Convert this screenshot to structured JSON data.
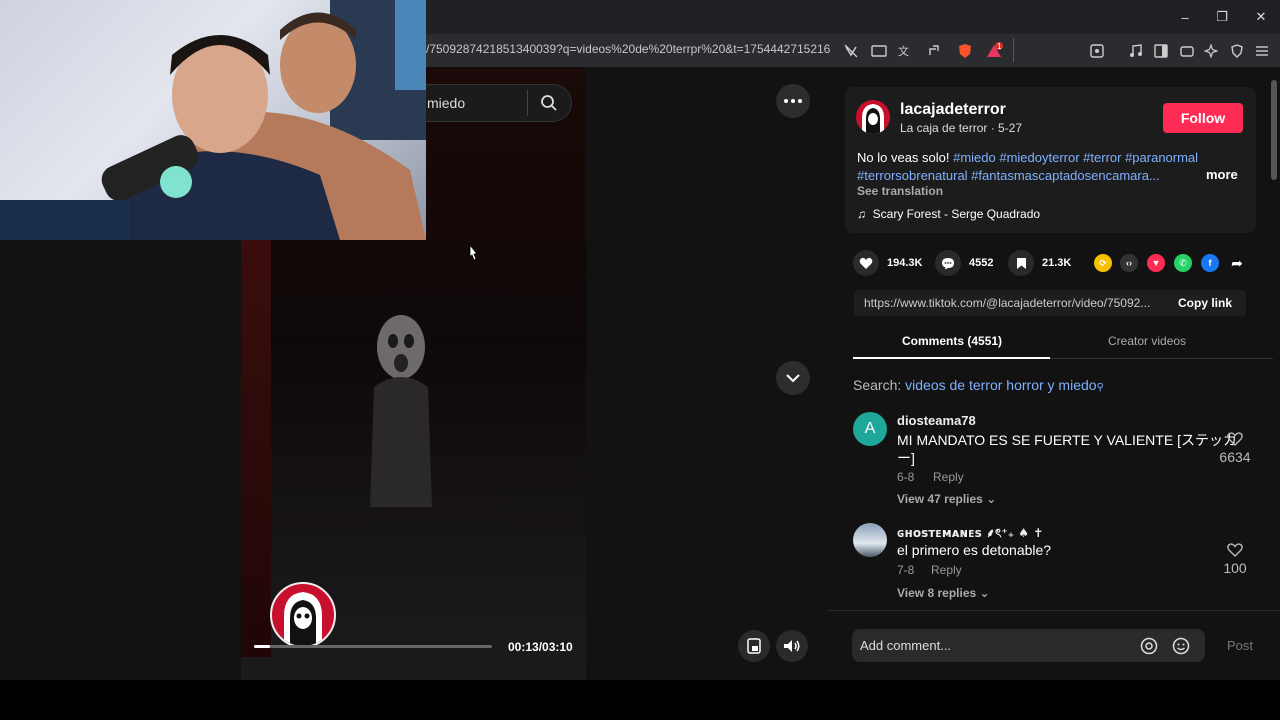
{
  "browser": {
    "url": "/7509287421851340039?q=videos%20de%20terrpr%20&t=1754442715216",
    "window_controls": [
      "–",
      "❐",
      "✕"
    ],
    "brave_badge": "1"
  },
  "video": {
    "search_text": "miedo",
    "time": "00:13/03:10",
    "progress": 0.068
  },
  "post": {
    "username": "lacajadeterror",
    "subline": "La caja de terror · 5-27",
    "follow_label": "Follow",
    "desc_plain": "No lo veas solo! ",
    "desc_tags1": "#miedo #miedoyterror #terror #paranormal",
    "desc_tags2": "#terrorsobrenatural #fantasmascaptadosencamara...",
    "more_label": "more",
    "see_translation": "See translation",
    "music": "Scary Forest - Serge Quadrado",
    "likes": "194.3K",
    "comments": "4552",
    "saves": "21.3K",
    "link": "https://www.tiktok.com/@lacajadeterror/video/75092...",
    "copy_link": "Copy link"
  },
  "tabs": {
    "comments": "Comments (4551)",
    "creator": "Creator videos"
  },
  "search_row": {
    "prefix": "Search: ",
    "query": "videos de terror horror y miedo"
  },
  "comments": [
    {
      "avatar_letter": "A",
      "name": "diosteama78",
      "text1": "MI MANDATO ES SE FUERTE Y VALIENTE [ステッカ",
      "text2": "ー]",
      "date": "6-8",
      "reply": "Reply",
      "replies": "View 47 replies",
      "likes": "6634"
    },
    {
      "avatar_letter": "",
      "name": "ɢʜᴏꜱᴛᴇᴍᴀɴᴇꜱ ⸙ৎ⁺₊ ♠ ✝",
      "text1": "el primero es detonable?",
      "date": "7-8",
      "reply": "Reply",
      "replies": "View 8 replies",
      "likes": "100"
    }
  ],
  "comment_box": {
    "placeholder": "Add comment...",
    "post": "Post"
  },
  "colors": {
    "accent": "#fe2c55",
    "tag": "#7fb1ff",
    "background": "#121212"
  }
}
